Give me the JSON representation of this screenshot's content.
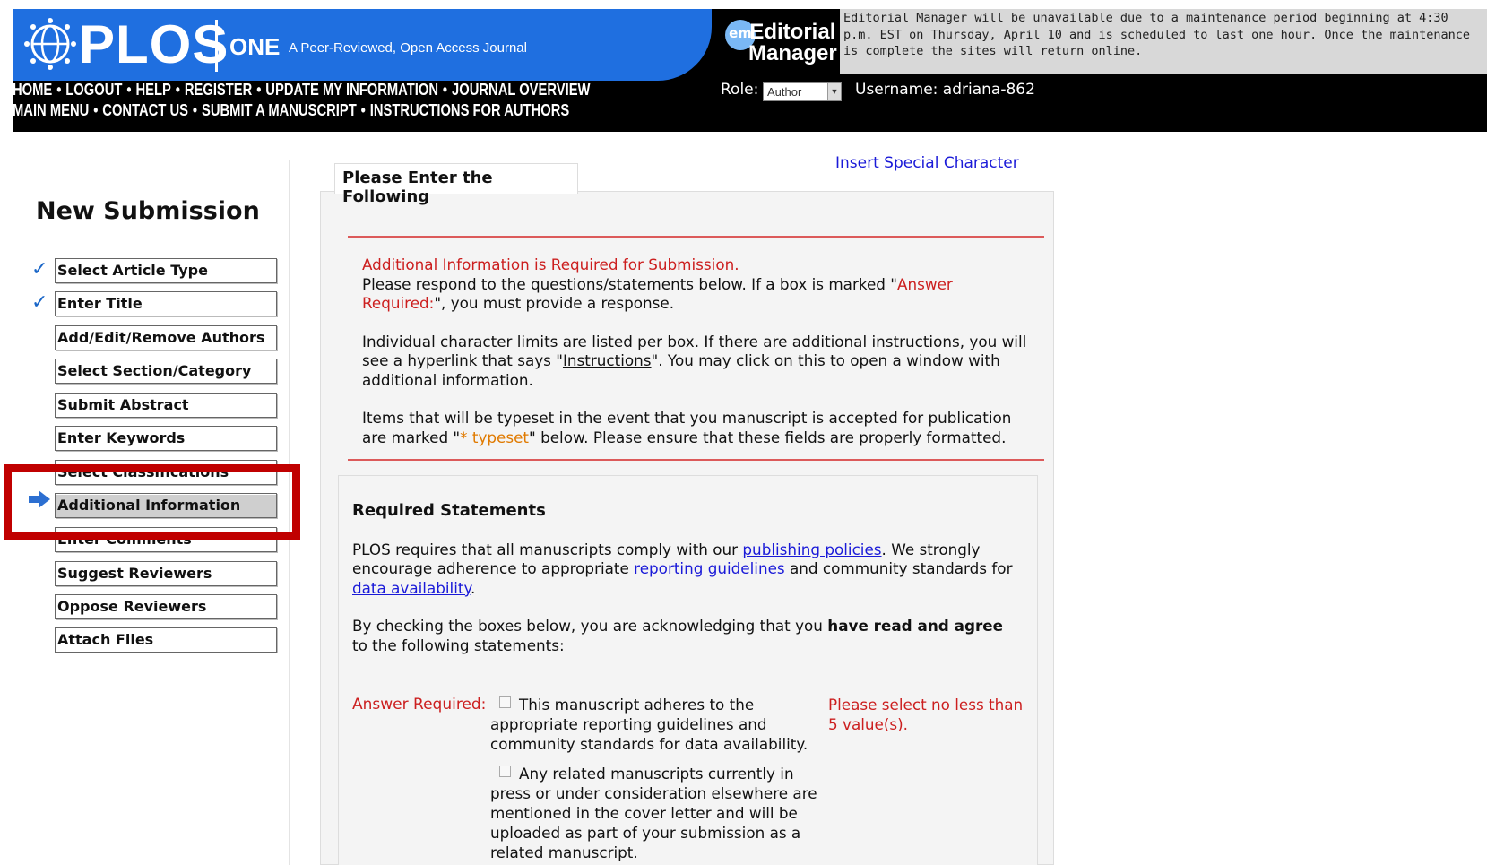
{
  "header": {
    "logo_text": "PLOS",
    "journal": "ONE",
    "tagline": "A Peer-Reviewed, Open Access Journal",
    "nav_row1": [
      "HOME",
      "LOGOUT",
      "HELP",
      "REGISTER",
      "UPDATE MY INFORMATION",
      "JOURNAL OVERVIEW"
    ],
    "nav_row2": [
      "MAIN MENU",
      "CONTACT US",
      "SUBMIT A MANUSCRIPT",
      "INSTRUCTIONS FOR AUTHORS"
    ],
    "em_badge": "em",
    "em_line1": "Editorial",
    "em_line2": "Manager",
    "maintenance": "Editorial Manager will be unavailable due to a maintenance period beginning at 4:30 p.m. EST on Thursday, April 10 and is scheduled to last one hour. Once the maintenance is complete the sites will return online.",
    "role_label": "Role:",
    "role_value": "Author",
    "username": "Username: adriana-862"
  },
  "sidebar": {
    "title": "New Submission",
    "steps": [
      {
        "label": "Select Article Type",
        "state": "done"
      },
      {
        "label": "Enter Title",
        "state": "done"
      },
      {
        "label": "Add/Edit/Remove Authors",
        "state": ""
      },
      {
        "label": "Select Section/Category",
        "state": ""
      },
      {
        "label": "Submit Abstract",
        "state": ""
      },
      {
        "label": "Enter Keywords",
        "state": ""
      },
      {
        "label": "Select Classifications",
        "state": ""
      },
      {
        "label": "Additional Information",
        "state": "current"
      },
      {
        "label": "Enter Comments",
        "state": ""
      },
      {
        "label": "Suggest Reviewers",
        "state": ""
      },
      {
        "label": "Oppose Reviewers",
        "state": ""
      },
      {
        "label": "Attach Files",
        "state": ""
      }
    ]
  },
  "main": {
    "tab_title": "Please Enter the Following",
    "special_char_link": "Insert Special Character",
    "notice": {
      "required_heading": "Additional Information is Required for Submission.",
      "p1_a": "Please respond to the questions/statements below. If a box is marked \"",
      "p1_b": "Answer Required:",
      "p1_c": "\", you must provide a response.",
      "p2_a": "Individual character limits are listed per box. If there are additional instructions, you will see a hyperlink that says \"",
      "p2_link": "Instructions",
      "p2_c": "\". You may click on this to open a window with additional information.",
      "p3_a": "Items that will be typeset in the event that you manuscript is accepted for publication are marked \"",
      "p3_b": "* typeset",
      "p3_c": "\" below. Please ensure that these fields are properly formatted."
    },
    "statements": {
      "heading": "Required Statements",
      "p1_a": "PLOS requires that all manuscripts comply with our ",
      "link_policies": "publishing policies",
      "p1_b": ". We strongly encourage adherence to appropriate ",
      "link_guidelines": "reporting guidelines",
      "p1_c": " and community standards for ",
      "link_data": "data availability",
      "p1_d": ".",
      "p2_a": "By checking the boxes below, you are acknowledging that you ",
      "p2_bold": "have read and agree",
      "p2_c": " to the following statements:",
      "answer_required": "Answer Required:",
      "checkbox1": "This manuscript adheres to the appropriate reporting guidelines and community standards for data availability.",
      "checkbox2": "Any related manuscripts currently in press or under consideration elsewhere are mentioned in the cover letter and will be uploaded as part of your submission as a related manuscript.",
      "min_note": "Please select no less than 5 value(s)."
    }
  },
  "colors": {
    "header_blue": "#1f6fe0",
    "highlight_red": "#c00000",
    "required_red": "#cc1f1f",
    "link_blue": "#1a1ad8",
    "check_blue": "#1b67c8"
  }
}
